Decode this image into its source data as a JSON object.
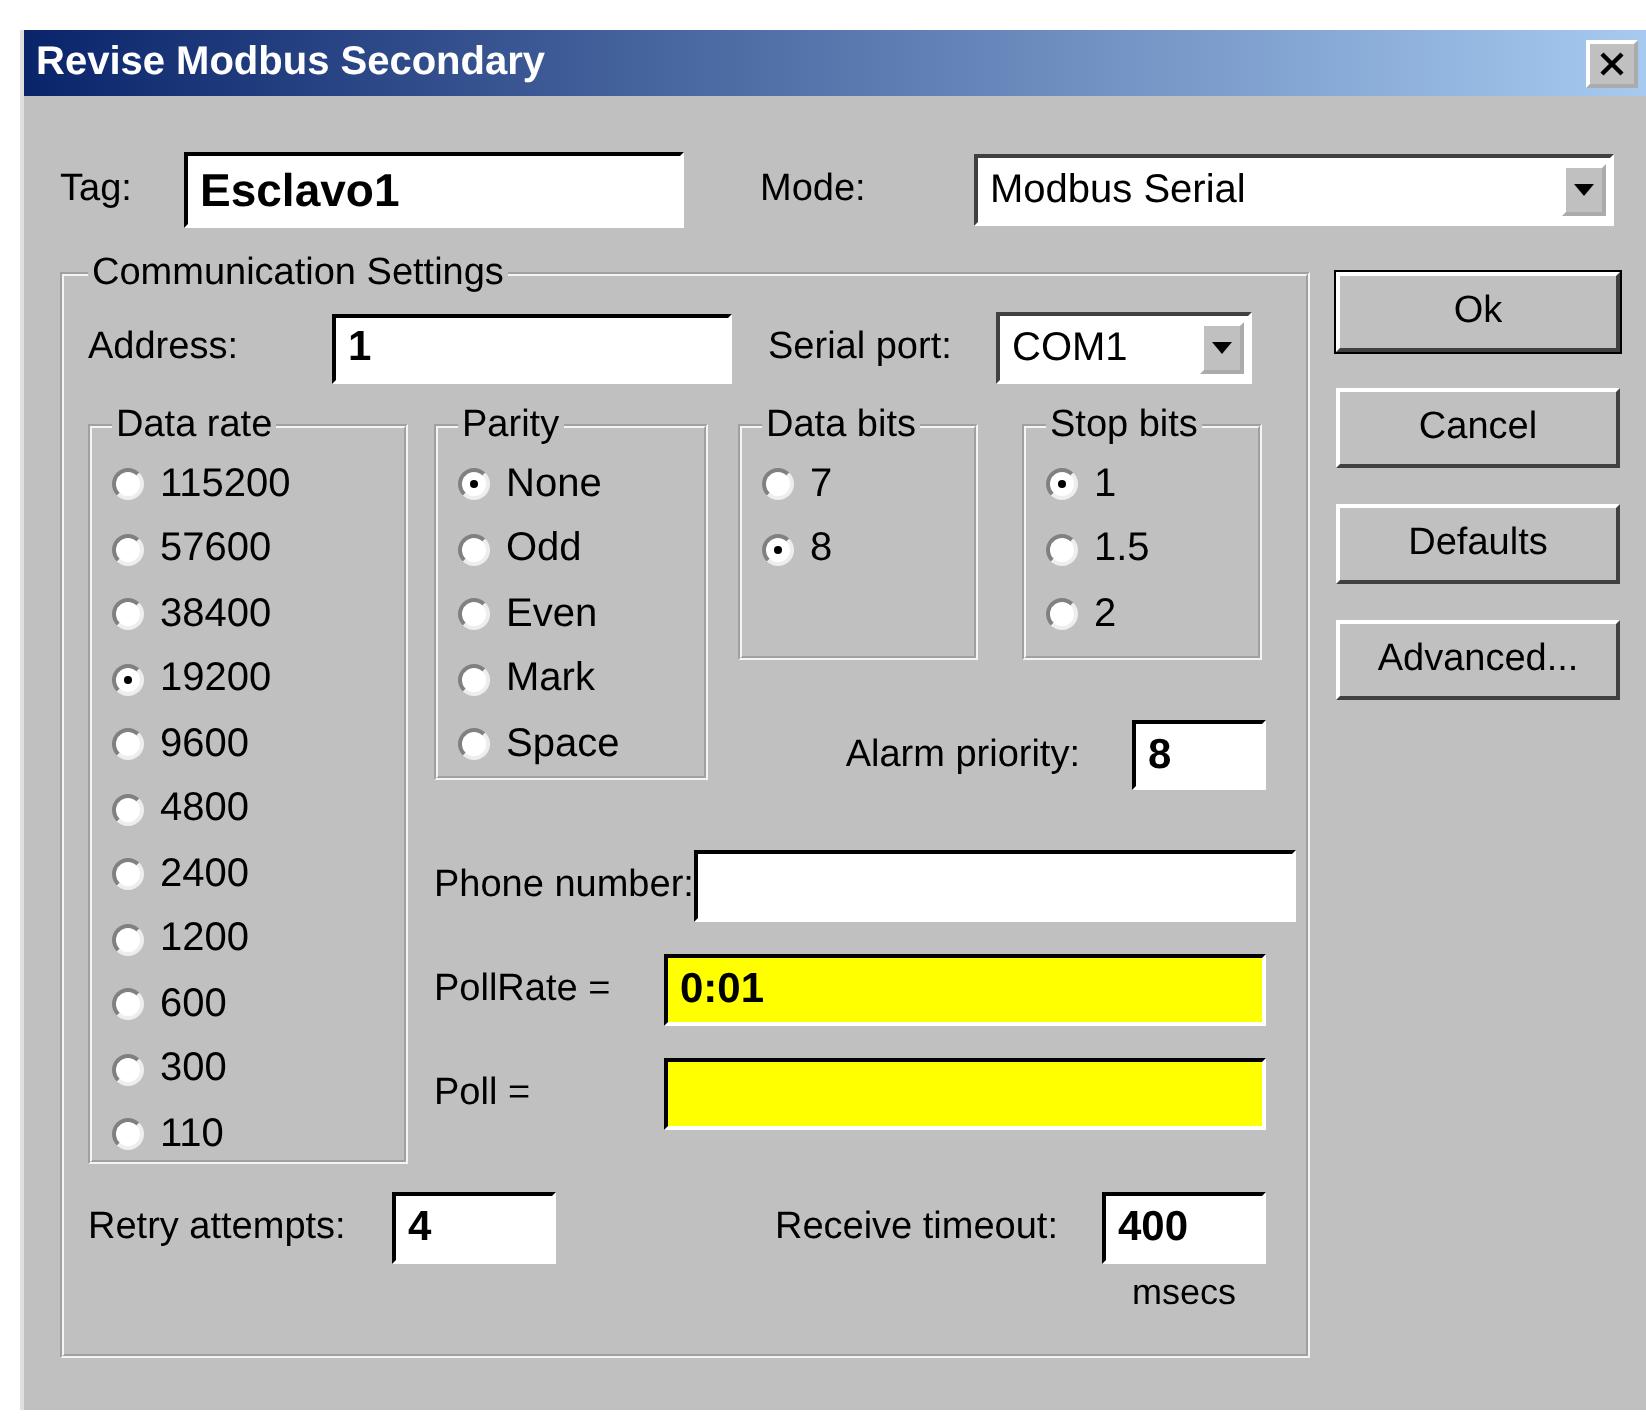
{
  "window": {
    "title": "Revise Modbus Secondary"
  },
  "tag": {
    "label": "Tag:",
    "value": "Esclavo1"
  },
  "mode": {
    "label": "Mode:",
    "value": "Modbus Serial"
  },
  "communication_settings": {
    "title": "Communication Settings",
    "address": {
      "label": "Address:",
      "value": "1"
    },
    "serial_port": {
      "label": "Serial port:",
      "value": "COM1"
    },
    "data_rate": {
      "title": "Data rate",
      "options": [
        {
          "label": "115200",
          "selected": false
        },
        {
          "label": "57600",
          "selected": false
        },
        {
          "label": "38400",
          "selected": false
        },
        {
          "label": "19200",
          "selected": true
        },
        {
          "label": "9600",
          "selected": false
        },
        {
          "label": "4800",
          "selected": false
        },
        {
          "label": "2400",
          "selected": false
        },
        {
          "label": "1200",
          "selected": false
        },
        {
          "label": "600",
          "selected": false
        },
        {
          "label": "300",
          "selected": false
        },
        {
          "label": "110",
          "selected": false
        }
      ]
    },
    "parity": {
      "title": "Parity",
      "options": [
        {
          "label": "None",
          "selected": true
        },
        {
          "label": "Odd",
          "selected": false
        },
        {
          "label": "Even",
          "selected": false
        },
        {
          "label": "Mark",
          "selected": false
        },
        {
          "label": "Space",
          "selected": false
        }
      ]
    },
    "data_bits": {
      "title": "Data bits",
      "options": [
        {
          "label": "7",
          "selected": false
        },
        {
          "label": "8",
          "selected": true
        }
      ]
    },
    "stop_bits": {
      "title": "Stop bits",
      "options": [
        {
          "label": "1",
          "selected": true
        },
        {
          "label": "1.5",
          "selected": false
        },
        {
          "label": "2",
          "selected": false
        }
      ]
    },
    "alarm_priority": {
      "label": "Alarm priority:",
      "value": "8"
    },
    "phone_number": {
      "label": "Phone number:"
    },
    "poll_rate": {
      "label": "PollRate =",
      "value": "0:01"
    },
    "poll": {
      "label": "Poll ="
    },
    "retry_attempts": {
      "label": "Retry attempts:",
      "value": "4"
    },
    "receive_timeout": {
      "label": "Receive timeout:",
      "value": "400",
      "unit": "msecs"
    }
  },
  "buttons": [
    {
      "label": "Ok",
      "default": true
    },
    {
      "label": "Cancel",
      "default": false
    },
    {
      "label": "Defaults",
      "default": false
    },
    {
      "label": "Advanced...",
      "default": false
    }
  ]
}
